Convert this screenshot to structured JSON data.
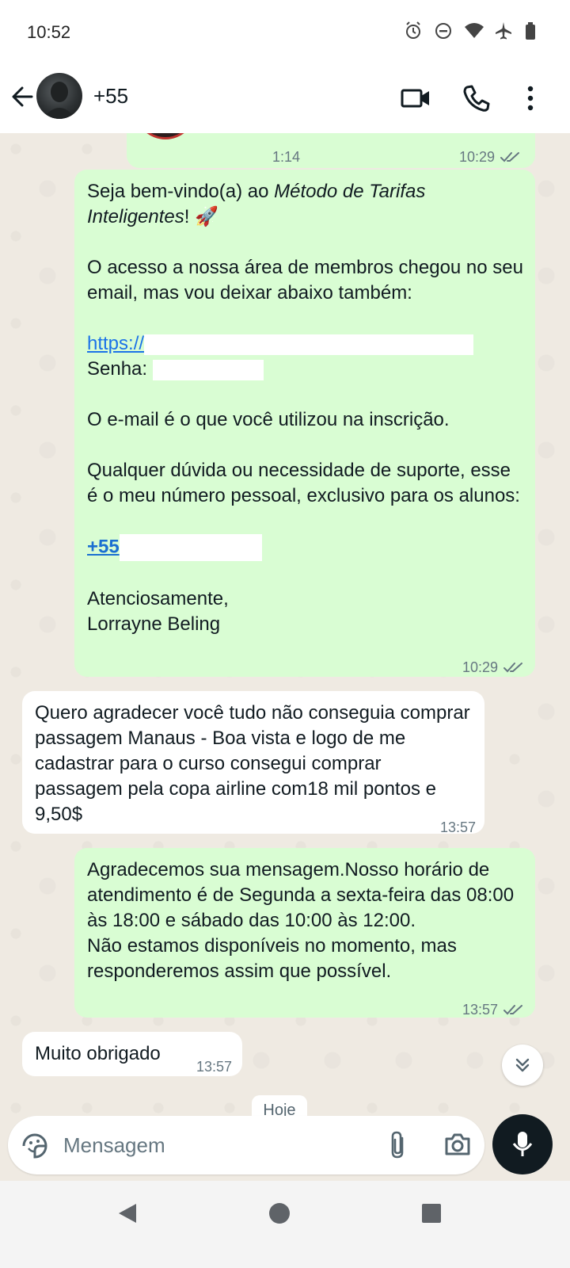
{
  "status_bar": {
    "time": "10:52"
  },
  "header": {
    "contact_name": "+55"
  },
  "messages": {
    "audio": {
      "duration": "1:14",
      "time": "10:29"
    },
    "welcome": {
      "intro_prefix": "Seja bem-vindo(a) ao ",
      "intro_italic": "Método de Tarifas Inteligentes",
      "intro_suffix": "! 🚀",
      "access_text": "O acesso a nossa área de membros chegou no seu email, mas vou deixar abaixo também:",
      "link_text": "https://",
      "password_label": "Senha: ",
      "email_text": "O e-mail é o que você utilizou na inscrição.",
      "support_text": "Qualquer dúvida ou necessidade de suporte, esse é o meu número pessoal, exclusivo para os alunos:",
      "phone_text": "+55",
      "closing_1": "Atenciosamente,",
      "closing_2": "Lorrayne Beling",
      "time": "10:29"
    },
    "incoming_1": {
      "text": "Quero agradecer você tudo não conseguia comprar passagem Manaus - Boa vista e logo de me cadastrar para o curso consegui comprar passagem pela copa airline com18 mil pontos e 9,50$",
      "time": "13:57"
    },
    "auto_reply": {
      "text": "Agradecemos sua mensagem.Nosso horário de atendimento é de Segunda a sexta-feira das 08:00 às 18:00 e sábado das 10:00 às 12:00.\nNão estamos disponíveis no momento, mas responderemos assim que possível.",
      "time": "13:57"
    },
    "incoming_2": {
      "text": "Muito obrigado",
      "time": "13:57"
    }
  },
  "date_chip": "Hoje",
  "composer": {
    "placeholder": "Mensagem"
  },
  "colors": {
    "outgoing_bubble": "#d9fdd3",
    "incoming_bubble": "#ffffff",
    "read_ticks": "#53bdeb",
    "link": "#1b72e8"
  }
}
